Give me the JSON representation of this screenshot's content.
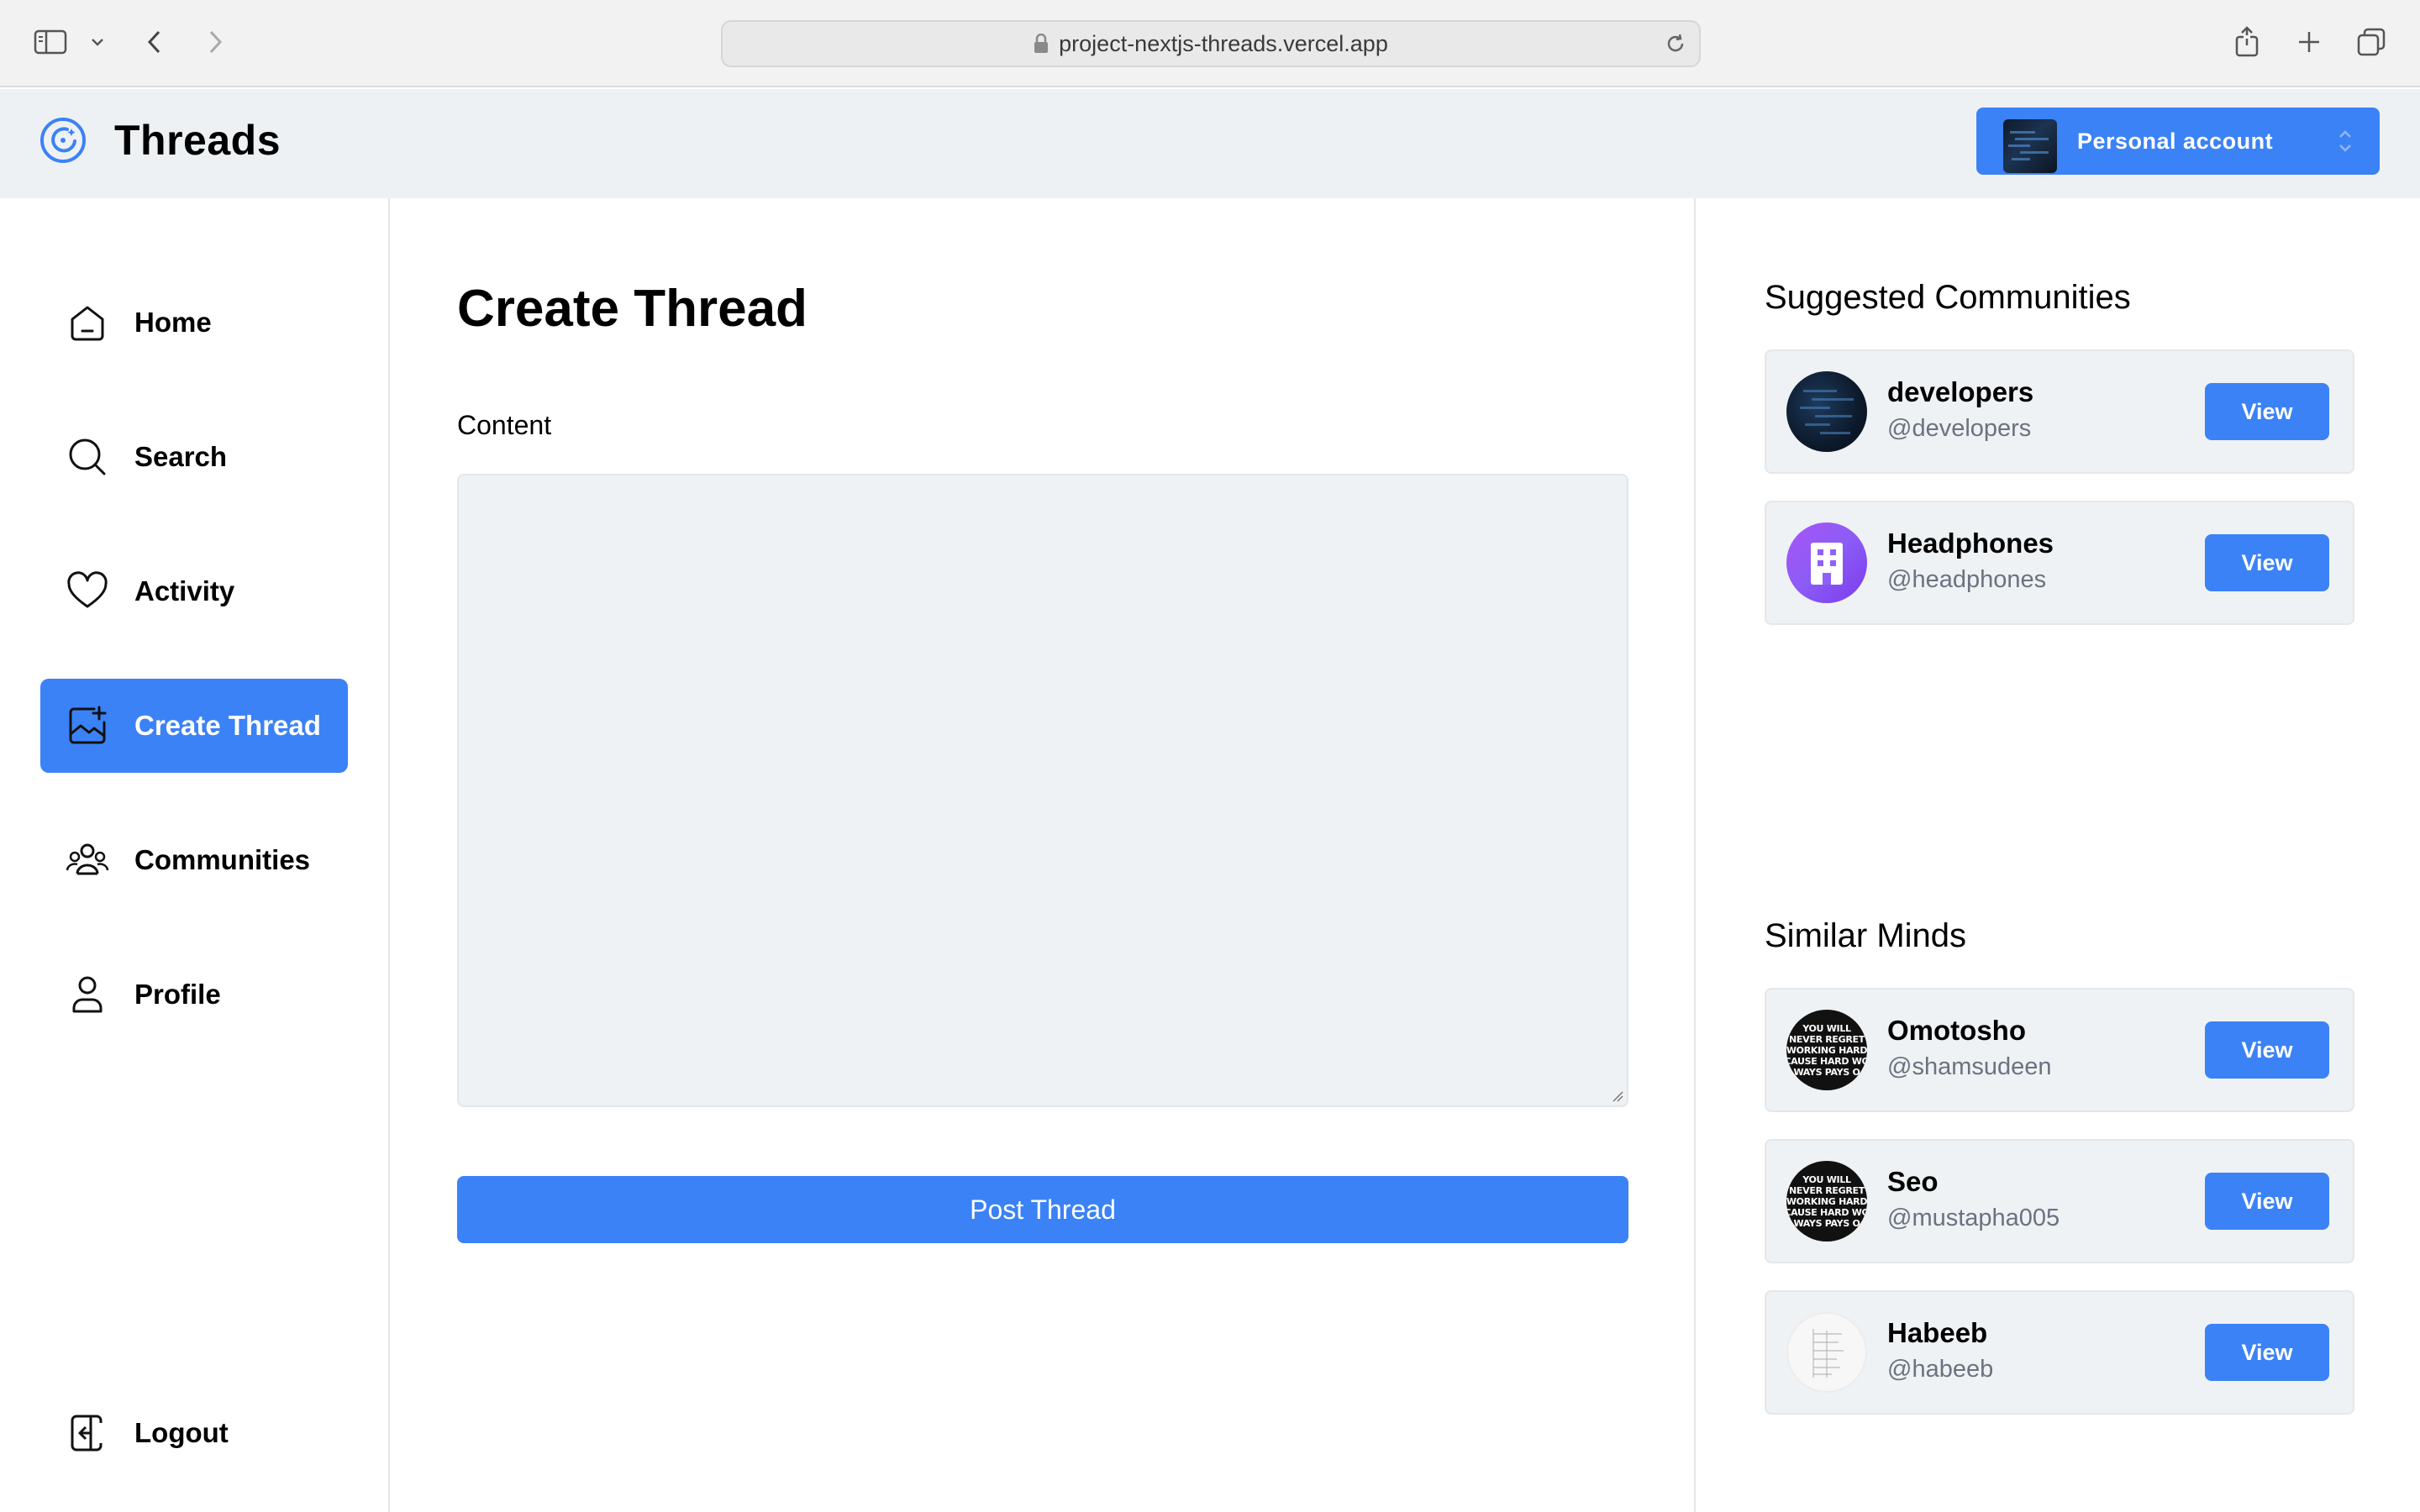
{
  "browser": {
    "url": "project-nextjs-threads.vercel.app"
  },
  "header": {
    "brand": "Threads",
    "account_label": "Personal account"
  },
  "sidebar": {
    "items": [
      {
        "label": "Home",
        "icon": "home-icon",
        "active": false
      },
      {
        "label": "Search",
        "icon": "search-icon",
        "active": false
      },
      {
        "label": "Activity",
        "icon": "heart-icon",
        "active": false
      },
      {
        "label": "Create Thread",
        "icon": "create-thread-icon",
        "active": true
      },
      {
        "label": "Communities",
        "icon": "communities-icon",
        "active": false
      },
      {
        "label": "Profile",
        "icon": "user-icon",
        "active": false
      }
    ],
    "logout_label": "Logout"
  },
  "main": {
    "title": "Create Thread",
    "content_label": "Content",
    "content_value": "",
    "submit_label": "Post Thread"
  },
  "right": {
    "communities_title": "Suggested Communities",
    "communities": [
      {
        "name": "developers",
        "handle": "@developers",
        "action": "View"
      },
      {
        "name": "Headphones",
        "handle": "@headphones",
        "action": "View"
      }
    ],
    "users_title": "Similar Minds",
    "users": [
      {
        "name": "Omotosho",
        "handle": "@shamsudeen",
        "action": "View"
      },
      {
        "name": "Seo",
        "handle": "@mustapha005",
        "action": "View"
      },
      {
        "name": "Habeeb",
        "handle": "@habeeb",
        "action": "View"
      }
    ],
    "avatar_motto_lines": [
      "YOU WILL",
      "NEVER REGRET",
      "WORKING HARD",
      "CAUSE HARD WO",
      "WAYS PAYS O"
    ]
  },
  "colors": {
    "accent": "#3b82f6",
    "header_bg": "#eef1f4",
    "card_bg": "#eff2f4",
    "muted_text": "#6b7280"
  }
}
